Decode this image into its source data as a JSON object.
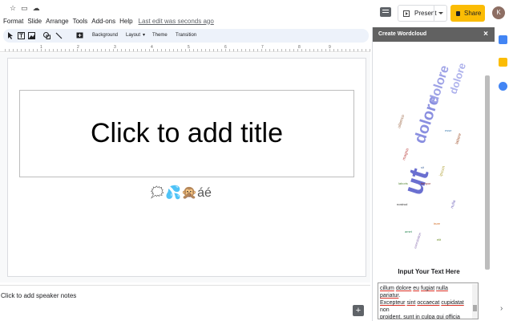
{
  "menu": {
    "items": [
      "Format",
      "Slide",
      "Arrange",
      "Tools",
      "Add-ons",
      "Help"
    ],
    "last_edit": "Last edit was seconds ago"
  },
  "header": {
    "present_label": "Present",
    "share_label": "Share",
    "avatar_initial": "K"
  },
  "toolbar": {
    "background_label": "Background",
    "layout_label": "Layout",
    "theme_label": "Theme",
    "transition_label": "Transition"
  },
  "ruler": {
    "numbers": [
      "1",
      "2",
      "3",
      "4",
      "5",
      "6",
      "7",
      "8",
      "9"
    ]
  },
  "slide": {
    "title_placeholder": "Click to add title",
    "emoji_text": "🗯💦🙊áé"
  },
  "notes": {
    "placeholder": "Click to add speaker notes"
  },
  "panel": {
    "title": "Create Wordcloud",
    "close_glyph": "×",
    "input_label": "Input Your Text Here",
    "wordcloud_words": [
      "ut",
      "dolore",
      "dolore",
      "dolore",
      "ullamco",
      "magna",
      "laboris",
      "sit",
      "nostrud",
      "tempor",
      "ipsum",
      "nulla",
      "irure",
      "amet",
      "labore",
      "elit",
      "esse",
      "exercitation"
    ],
    "textarea_lines": [
      [
        {
          "t": "cillum",
          "u": true
        },
        {
          "t": " "
        },
        {
          "t": "dolore",
          "u": true
        },
        {
          "t": " "
        },
        {
          "t": "eu",
          "u": true
        },
        {
          "t": " "
        },
        {
          "t": "fugiat",
          "u": true
        },
        {
          "t": " "
        },
        {
          "t": "nulla",
          "u": true
        },
        {
          "t": " "
        },
        {
          "t": "pariatur",
          "u": true
        },
        {
          "t": "."
        }
      ],
      [
        {
          "t": "Excepteur",
          "u": true
        },
        {
          "t": " "
        },
        {
          "t": "sint",
          "u": true
        },
        {
          "t": " "
        },
        {
          "t": "occaecat",
          "u": true
        },
        {
          "t": " "
        },
        {
          "t": "cupidatat",
          "u": true
        }
      ],
      [
        {
          "t": "non"
        }
      ],
      [
        {
          "t": "proident, "
        },
        {
          "t": "sunt in culpa qui officia"
        }
      ]
    ]
  },
  "colors": {
    "share": "#fbbc04",
    "panel_header": "#616161",
    "wordcloud_main": "#7b7fd4"
  }
}
